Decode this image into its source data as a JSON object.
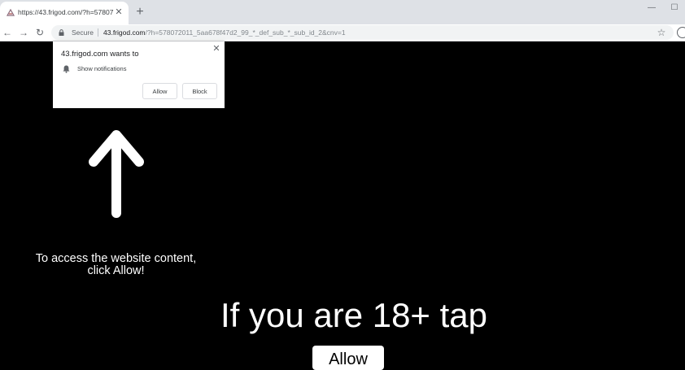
{
  "browser": {
    "tab": {
      "title": "https://43.frigod.com/?h=57807...",
      "close_glyph": "✕",
      "favicon_icon": "site-favicon-icon"
    },
    "new_tab_glyph": "+",
    "window_controls": {
      "minimize_glyph": "—",
      "maximize_glyph": "☐"
    },
    "nav": {
      "back_glyph": "←",
      "forward_glyph": "→",
      "reload_glyph": "↻"
    },
    "omnibox": {
      "secure_label": "Secure",
      "url_host": "43.frigod.com",
      "url_path": "/?h=578072011_5aa678f47d2_99_*_def_sub_*_sub_id_2&cnv=1"
    },
    "bookmark_glyph": "☆"
  },
  "notification_popup": {
    "title": "43.frigod.com wants to",
    "permission_label": "Show notifications",
    "allow_label": "Allow",
    "block_label": "Block",
    "close_glyph": "✕"
  },
  "page": {
    "instruction_line1": "To access the website content,",
    "instruction_line2": "click Allow!",
    "headline": "If you are 18+ tap",
    "allow_button_label": "Allow"
  },
  "colors": {
    "page_background": "#000000",
    "text": "#ffffff",
    "tabstrip": "#dee1e6"
  }
}
